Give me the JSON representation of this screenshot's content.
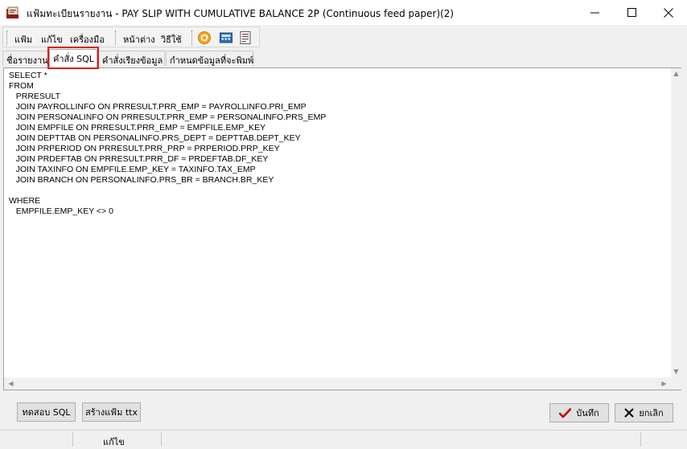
{
  "window": {
    "title": "แฟ้มทะเบียนรายงาน - PAY SLIP WITH CUMULATIVE BALANCE 2P (Continuous feed paper)(2)"
  },
  "menu": {
    "items": [
      "แฟ้ม",
      "แก้ไข",
      "เครื่องมือ",
      "หน้าต่าง",
      "วิธีใช้"
    ]
  },
  "tabs": [
    "ชื่อรายงาน",
    "คำสั่ง SQL",
    "คำสั่งเรียงข้อมูล",
    "กำหนดข้อมูลที่จะพิมพ์"
  ],
  "active_tab": "คำสั่ง SQL",
  "sql": "SELECT *\nFROM\n   PRRESULT\n   JOIN PAYROLLINFO ON PRRESULT.PRR_EMP = PAYROLLINFO.PRI_EMP\n   JOIN PERSONALINFO ON PRRESULT.PRR_EMP = PERSONALINFO.PRS_EMP\n   JOIN EMPFILE ON PRRESULT.PRR_EMP = EMPFILE.EMP_KEY\n   JOIN DEPTTAB ON PERSONALINFO.PRS_DEPT = DEPTTAB.DEPT_KEY\n   JOIN PRPERIOD ON PRRESULT.PRR_PRP = PRPERIOD.PRP_KEY\n   JOIN PRDEFTAB ON PRRESULT.PRR_DF = PRDEFTAB.DF_KEY\n   JOIN TAXINFO ON EMPFILE.EMP_KEY = TAXINFO.TAX_EMP\n   JOIN BRANCH ON PERSONALINFO.PRS_BR = BRANCH.BR_KEY\n\nWHERE\n   EMPFILE.EMP_KEY <> 0",
  "buttons": {
    "test_sql": "ทดสอบ SQL",
    "create_ttx": "สร้างแฟ้ม ttx",
    "save": "บันทึก",
    "cancel": "ยกเลิก"
  },
  "status": {
    "mode": "แก้ไข"
  },
  "colors": {
    "highlight": "#e01b1b",
    "save_check": "#c40000"
  }
}
